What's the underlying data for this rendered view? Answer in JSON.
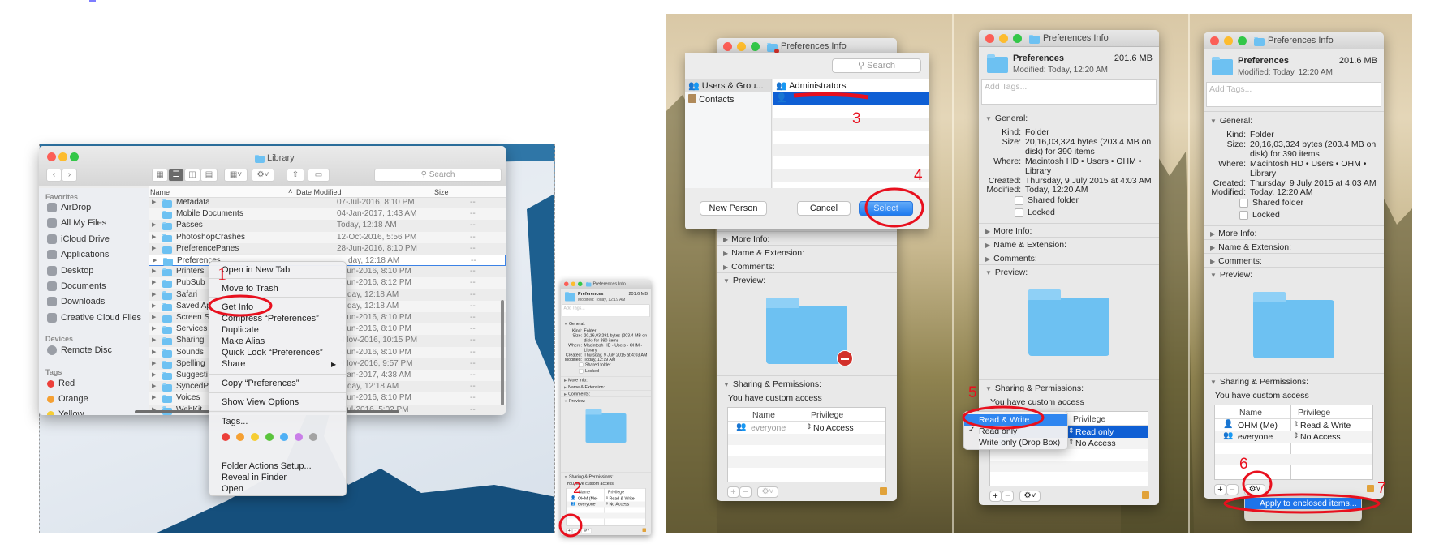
{
  "finder": {
    "title": "Library",
    "search_placeholder": "Search",
    "sidebar": {
      "favorites_label": "Favorites",
      "favorites": [
        "AirDrop",
        "All My Files",
        "iCloud Drive",
        "Applications",
        "Desktop",
        "Documents",
        "Downloads",
        "Creative Cloud Files"
      ],
      "devices_label": "Devices",
      "devices": [
        "Remote Disc"
      ],
      "tags_label": "Tags",
      "tags": [
        {
          "label": "Red",
          "color": "#ec3f3a"
        },
        {
          "label": "Orange",
          "color": "#f5a033"
        },
        {
          "label": "Yellow",
          "color": "#f6cd33"
        }
      ]
    },
    "columns": {
      "name": "Name",
      "date": "Date Modified",
      "size": "Size"
    },
    "rows": [
      {
        "name": "Metadata",
        "date": "07-Jul-2016, 8:10 PM",
        "size": "--"
      },
      {
        "name": "Mobile Documents",
        "date": "04-Jan-2017, 1:43 AM",
        "size": "--"
      },
      {
        "name": "Passes",
        "date": "Today, 12:18 AM",
        "size": "--"
      },
      {
        "name": "PhotoshopCrashes",
        "date": "12-Oct-2016, 5:56 PM",
        "size": "--"
      },
      {
        "name": "PreferencePanes",
        "date": "28-Jun-2016, 8:10 PM",
        "size": "--"
      },
      {
        "name": "Preferences",
        "date": "day, 12:18 AM",
        "size": "--"
      },
      {
        "name": "Printers",
        "date": "-Jun-2016, 8:10 PM",
        "size": "--"
      },
      {
        "name": "PubSub",
        "date": "-Jun-2016, 8:12 PM",
        "size": "--"
      },
      {
        "name": "Safari",
        "date": "day, 12:18 AM",
        "size": "--"
      },
      {
        "name": "Saved Ap",
        "date": "day, 12:18 AM",
        "size": "--"
      },
      {
        "name": "Screen S",
        "date": "-Jun-2016, 8:10 PM",
        "size": "--"
      },
      {
        "name": "Services",
        "date": "-Jun-2016, 8:10 PM",
        "size": "--"
      },
      {
        "name": "Sharing",
        "date": "-Nov-2016, 10:15 PM",
        "size": "--"
      },
      {
        "name": "Sounds",
        "date": "-Jun-2016, 8:10 PM",
        "size": "--"
      },
      {
        "name": "Spelling",
        "date": "-Nov-2016, 9:57 PM",
        "size": "--"
      },
      {
        "name": "Suggesti",
        "date": "-Jan-2017, 4:38 AM",
        "size": "--"
      },
      {
        "name": "SyncedP",
        "date": "day, 12:18 AM",
        "size": "--"
      },
      {
        "name": "Voices",
        "date": "-Jun-2016, 8:10 PM",
        "size": "--"
      },
      {
        "name": "WebKit",
        "date": "-Jul-2016, 5:02 PM",
        "size": "--"
      }
    ],
    "selected_row": "Preferences"
  },
  "context_menu": {
    "items": [
      "Open in New Tab",
      "Move to Trash",
      "Get Info",
      "Compress “Preferences”",
      "Duplicate",
      "Make Alias",
      "Quick Look “Preferences”",
      "Share",
      "Copy “Preferences”",
      "Show View Options",
      "Tags...",
      "Folder Actions Setup...",
      "Reveal in Finder",
      "Open"
    ],
    "tag_colors": [
      "#ec3f3a",
      "#f5a033",
      "#f6cd33",
      "#5ac43c",
      "#4fb0f5",
      "#c97ee8",
      "#a3a3a3"
    ],
    "highlighted": "Get Info"
  },
  "labels": {
    "tags_placeholder": "Add Tags...",
    "general": "General:",
    "kind": "Kind:",
    "size": "Size:",
    "where": "Where:",
    "created": "Created:",
    "modified": "Modified:",
    "shared_folder": "Shared folder",
    "locked": "Locked",
    "more_info": "More Info:",
    "name_ext": "Name & Extension:",
    "comments": "Comments:",
    "preview": "Preview:",
    "sharing": "Sharing & Permissions:",
    "custom_access": "You have custom access",
    "col_name": "Name",
    "col_priv": "Privilege"
  },
  "panels": {
    "p1": {
      "title": "Preferences Info",
      "name": "Preferences",
      "size_short": "201.6 MB",
      "modified_line": "Modified: Today, 12:19 AM",
      "kind": "Folder",
      "size_1": "20,16,03,291 bytes (203.4 MB on",
      "size_2": "disk) for 390 items",
      "where_1": "Macintosh HD • Users • OHM •",
      "where_2": "Library",
      "created": "Thursday, 9 July 2015 at 4:03 AM",
      "modified": "Today, 12:19 AM",
      "rows": [
        {
          "name": "OHM (Me)",
          "priv": "Read & Write",
          "icon": "user"
        },
        {
          "name": "everyone",
          "priv": "No Access",
          "icon": "group"
        }
      ]
    },
    "p2": {
      "title": "Preferences Info",
      "rows": [
        {
          "name": "everyone",
          "priv": "No Access",
          "icon": "group",
          "dim": true
        }
      ]
    },
    "p3": {
      "title": "Preferences Info",
      "name": "Preferences",
      "size_short": "201.6 MB",
      "modified_line": "Modified: Today, 12:20 AM",
      "kind": "Folder",
      "size_1": "20,16,03,324 bytes (203.4 MB on",
      "size_2": "disk) for 390 items",
      "where_1": "Macintosh HD • Users • OHM •",
      "where_2": "Library",
      "created": "Thursday, 9 July 2015 at 4:03 AM",
      "modified": "Today, 12:20 AM",
      "rows": [
        {
          "name": "",
          "priv": "Read only",
          "icon": "user",
          "selected": true
        },
        {
          "name": "",
          "priv": "No Access",
          "icon": "group"
        }
      ]
    },
    "p4": {
      "title": "Preferences Info",
      "name": "Preferences",
      "size_short": "201.6 MB",
      "modified_line": "Modified: Today, 12:20 AM",
      "kind": "Folder",
      "size_1": "20,16,03,324 bytes (203.4 MB on",
      "size_2": "disk) for 390 items",
      "where_1": "Macintosh HD • Users • OHM •",
      "where_2": "Library",
      "created": "Thursday, 9 July 2015 at 4:03 AM",
      "modified": "Today, 12:20 AM",
      "rows": [
        {
          "name": "OHM (Me)",
          "priv": "Read & Write",
          "icon": "user"
        },
        {
          "name": "everyone",
          "priv": "No Access",
          "icon": "group"
        }
      ]
    }
  },
  "user_picker": {
    "search_placeholder": "Search",
    "sources": [
      "Users & Grou...",
      "Contacts"
    ],
    "entries": [
      "Administrators",
      ""
    ],
    "buttons": {
      "new_person": "New Person",
      "cancel": "Cancel",
      "select": "Select"
    }
  },
  "privilege_menu": {
    "items": [
      "Read & Write",
      "Read only",
      "Write only (Drop Box)"
    ],
    "checked": "Read only",
    "highlighted": "Read & Write"
  },
  "gear_menu": {
    "items": [
      "Apply to enclosed items..."
    ]
  },
  "annotations": {
    "step1": "1",
    "step2": "2",
    "step3": "3",
    "step4": "4",
    "step5": "5",
    "step6": "6",
    "step7": "7",
    "color": "#e8101e"
  }
}
